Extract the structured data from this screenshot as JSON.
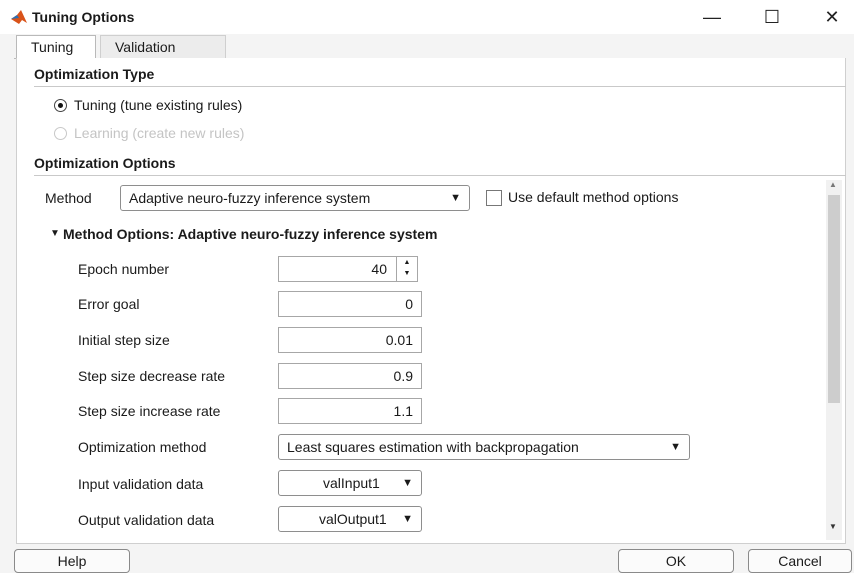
{
  "window": {
    "title": "Tuning Options",
    "controls": {
      "minimize": "—",
      "maximize": "☐",
      "close": "✕"
    }
  },
  "tabs": [
    {
      "label": "Tuning",
      "active": true
    },
    {
      "label": "Validation",
      "active": false
    }
  ],
  "optimization_type": {
    "heading": "Optimization Type",
    "options": [
      {
        "label": "Tuning (tune existing rules)",
        "selected": true,
        "enabled": true
      },
      {
        "label": "Learning (create new rules)",
        "selected": false,
        "enabled": false
      }
    ]
  },
  "optimization_options": {
    "heading": "Optimization Options",
    "method_label": "Method",
    "method_value": "Adaptive neuro-fuzzy inference system",
    "use_default_label": "Use default method options",
    "use_default_checked": false
  },
  "method_options": {
    "heading": "Method Options: Adaptive neuro-fuzzy inference system",
    "rows": [
      {
        "label": "Epoch number",
        "value": "40"
      },
      {
        "label": "Error goal",
        "value": "0"
      },
      {
        "label": "Initial step size",
        "value": "0.01"
      },
      {
        "label": "Step size decrease rate",
        "value": "0.9"
      },
      {
        "label": "Step size increase rate",
        "value": "1.1"
      },
      {
        "label": "Optimization method",
        "value": "Least squares estimation with backpropagation"
      },
      {
        "label": "Input validation data",
        "value": "valInput1"
      },
      {
        "label": "Output validation data",
        "value": "valOutput1"
      }
    ]
  },
  "footer": {
    "help": "Help",
    "ok": "OK",
    "cancel": "Cancel"
  },
  "colors": {
    "matlab_logo": "#d95319",
    "panel_bg": "#ffffff",
    "window_bg": "#f4f4f4"
  }
}
